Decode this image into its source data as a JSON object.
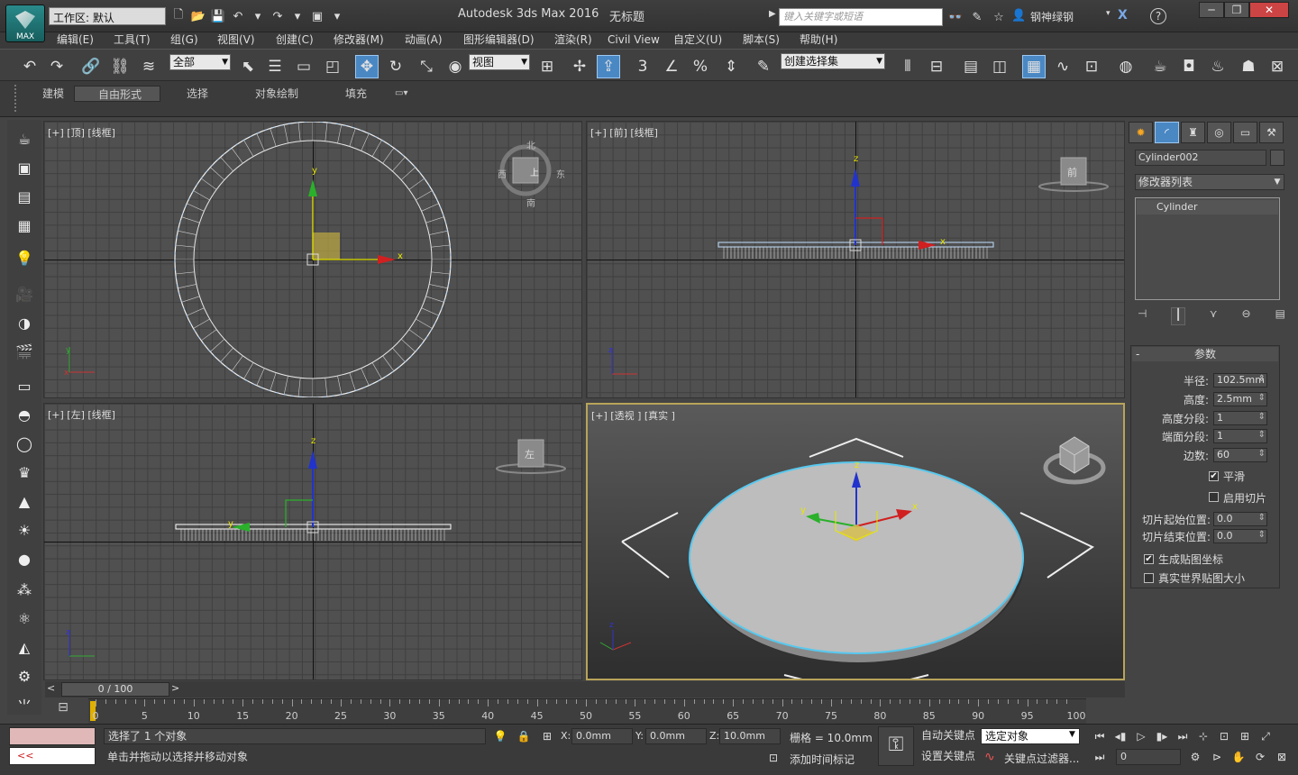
{
  "app": {
    "title": "Autodesk 3ds Max 2016",
    "doc": "无标题",
    "logo_text": "MAX"
  },
  "quick": {
    "workspace": "工作区: 默认",
    "search_placeholder": "键入关键字或短语",
    "user": "钢神绿钢"
  },
  "menu": [
    "编辑(E)",
    "工具(T)",
    "组(G)",
    "视图(V)",
    "创建(C)",
    "修改器(M)",
    "动画(A)",
    "图形编辑器(D)",
    "渲染(R)",
    "Civil View",
    "自定义(U)",
    "脚本(S)",
    "帮助(H)"
  ],
  "toolbar": {
    "filter": "全部",
    "refcoord": "视图",
    "selset": "创建选择集",
    "snap_angle": "3"
  },
  "ribbon": {
    "tabs": [
      "建模",
      "自由形式",
      "选择",
      "对象绘制",
      "填充"
    ],
    "active": "自由形式"
  },
  "viewports": {
    "top": "[+] [顶] [线框]",
    "front": "[+] [前] [线框]",
    "left": "[+] [左] [线框]",
    "persp": "[+] [透视 ] [真实 ]",
    "compass": {
      "n": "北",
      "s": "南",
      "e": "东",
      "w": "西",
      "top": "上"
    },
    "cube_front": "前",
    "cube_left": "左"
  },
  "cmd": {
    "object_name": "Cylinder002",
    "modifier_list": "修改器列表",
    "stack_item": "Cylinder",
    "rollout": "参数",
    "params": [
      {
        "label": "半径:",
        "value": "102.5mm"
      },
      {
        "label": "高度:",
        "value": "2.5mm"
      },
      {
        "label": "高度分段:",
        "value": "1"
      },
      {
        "label": "端面分段:",
        "value": "1"
      },
      {
        "label": "边数:",
        "value": "60"
      }
    ],
    "smooth": "平滑",
    "slice_on": "启用切片",
    "slice_from": "切片起始位置:",
    "slice_from_v": "0.0",
    "slice_to": "切片结束位置:",
    "slice_to_v": "0.0",
    "gen_uv": "生成贴图坐标",
    "real_world": "真实世界贴图大小"
  },
  "time": {
    "slider": "0 / 100",
    "ticks": [
      "0",
      "5",
      "10",
      "15",
      "20",
      "25",
      "30",
      "35",
      "40",
      "45",
      "50",
      "55",
      "60",
      "65",
      "70",
      "75",
      "80",
      "85",
      "90",
      "95",
      "100"
    ]
  },
  "status": {
    "selected": "选择了 1 个对象",
    "prompt": "单击并拖动以选择并移动对象",
    "x_label": "X:",
    "x": "0.0mm",
    "y_label": "Y:",
    "y": "0.0mm",
    "z_label": "Z:",
    "z": "10.0mm",
    "grid": "栅格 = 10.0mm",
    "add_tag": "添加时间标记",
    "autokey": "自动关键点",
    "setkey": "设置关键点",
    "keymode": "选定对象",
    "keyfilter": "关键点过滤器...",
    "frame": "0"
  }
}
